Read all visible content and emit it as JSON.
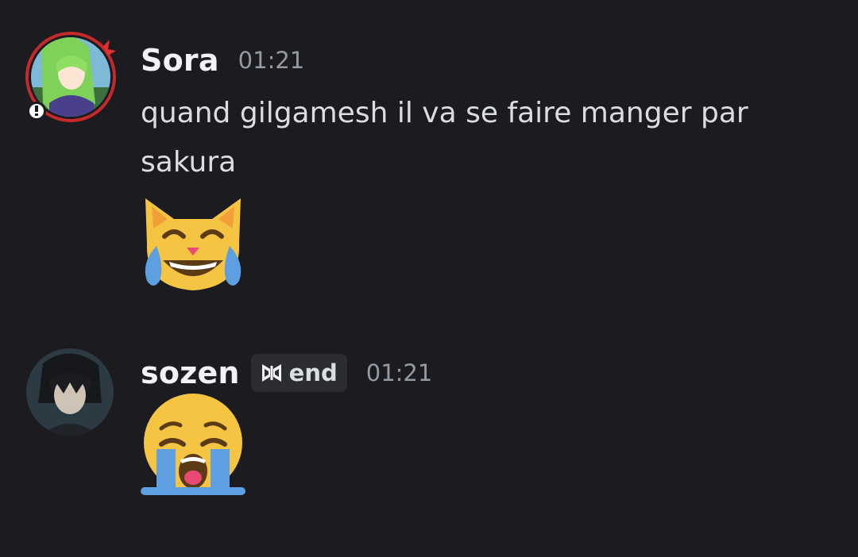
{
  "messages": [
    {
      "author": "Sora",
      "timestamp": "01:21",
      "text": "quand gilgamesh il va se faire manger par sakura",
      "emoji": "crying-laughing-cat"
    },
    {
      "author": "sozen",
      "tag": "end",
      "timestamp": "01:21",
      "emoji": "loudly-crying-face"
    }
  ],
  "colors": {
    "background": "#1b1b20",
    "username": "#f2f3f5",
    "timestamp": "#949ba4",
    "tag_background": "#2b2d31",
    "emoji_yellow": "#f6c443",
    "tear_blue": "#5d9fe0"
  }
}
